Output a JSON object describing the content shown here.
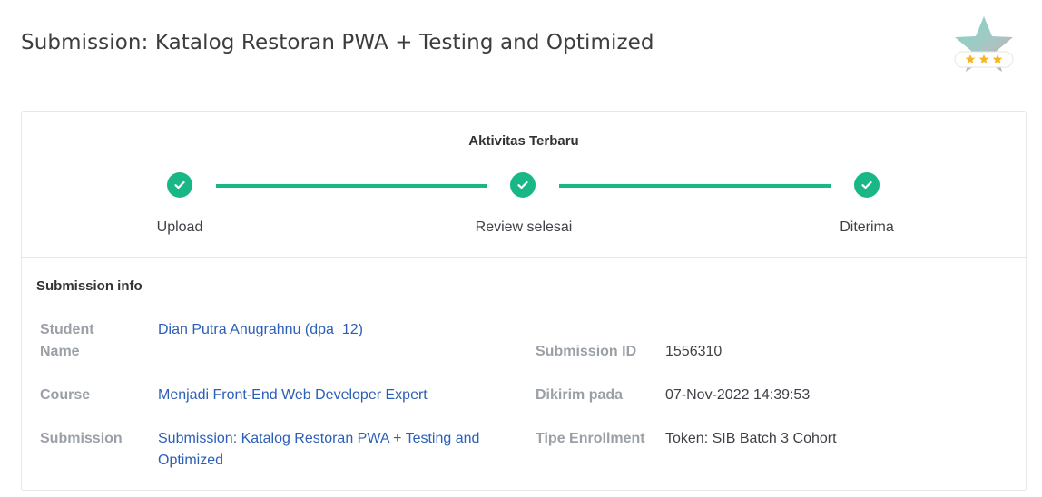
{
  "header": {
    "title": "Submission: Katalog Restoran PWA + Testing and Optimized",
    "badge_icon": "star-rating-badge-icon",
    "badge_stars": 3
  },
  "activity": {
    "title": "Aktivitas Terbaru",
    "steps": [
      {
        "label": "Upload",
        "status": "done"
      },
      {
        "label": "Review selesai",
        "status": "done"
      },
      {
        "label": "Diterima",
        "status": "done"
      }
    ],
    "accent_color": "#19b786"
  },
  "submission_info": {
    "title": "Submission info",
    "student_name_label": "Student Name",
    "student_name": "Dian Putra Anugrahnu (dpa_12)",
    "course_label": "Course",
    "course": "Menjadi Front-End Web Developer Expert",
    "submission_label": "Submission",
    "submission": "Submission: Katalog Restoran PWA + Testing and Optimized",
    "submission_id_label": "Submission ID",
    "submission_id": "1556310",
    "sent_label": "Dikirim pada",
    "sent_at": "07-Nov-2022 14:39:53",
    "enrollment_label": "Tipe Enrollment",
    "enrollment": "Token: SIB Batch 3 Cohort"
  }
}
